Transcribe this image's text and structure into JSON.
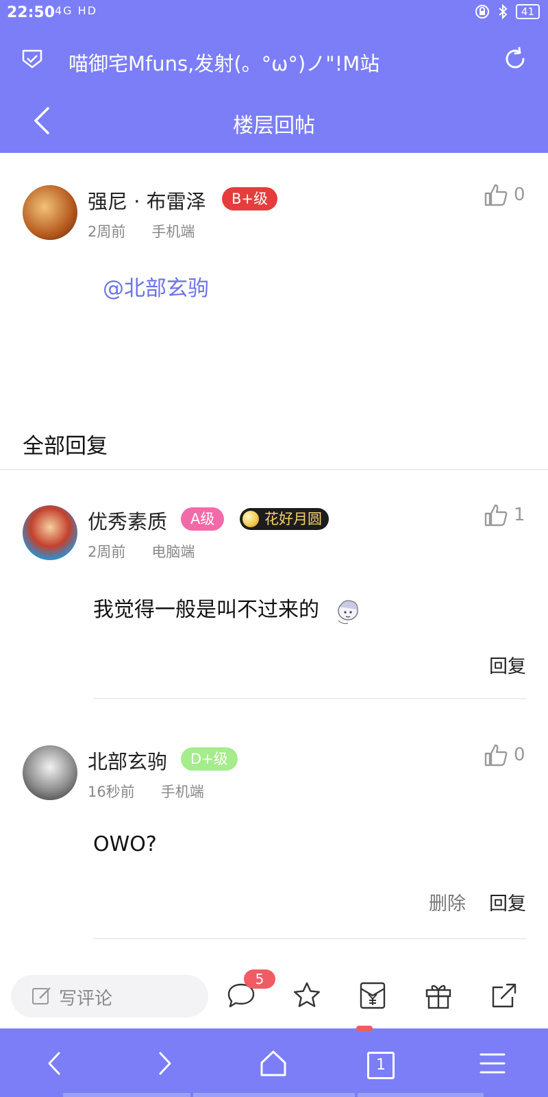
{
  "status_bar": {
    "time": "22:50",
    "signal": "4G HD",
    "battery": "41"
  },
  "browser": {
    "title": "喵御宅Mfuns,发射(。°ω°)ノ\"!M站"
  },
  "nav": {
    "title": "楼层回帖"
  },
  "original_post": {
    "username": "强尼 · 布雷泽",
    "level": "B+级",
    "time": "2周前",
    "device": "手机端",
    "likes": "0",
    "mention": "@北部玄驹"
  },
  "section_title": "全部回复",
  "replies": [
    {
      "username": "优秀素质",
      "level": "A级",
      "medal": "花好月圆",
      "time": "2周前",
      "device": "电脑端",
      "likes": "1",
      "content": "我觉得一般是叫不过来的",
      "reply_label": "回复"
    },
    {
      "username": "北部玄驹",
      "level": "D+级",
      "time": "16秒前",
      "device": "手机端",
      "likes": "0",
      "content": "OWO?",
      "delete_label": "删除",
      "reply_label": "回复"
    }
  ],
  "bottom_bar": {
    "comment_placeholder": "写评论",
    "comment_count": "5"
  },
  "system_nav": {
    "tab_count": "1"
  },
  "colors": {
    "theme": "#7b7ef6",
    "badge_b_plus": "#e53d3d",
    "badge_a": "#f36aa8",
    "badge_d_plus": "#a5ec8c",
    "mention": "#6c72e8",
    "count_badge": "#ef5c64"
  }
}
